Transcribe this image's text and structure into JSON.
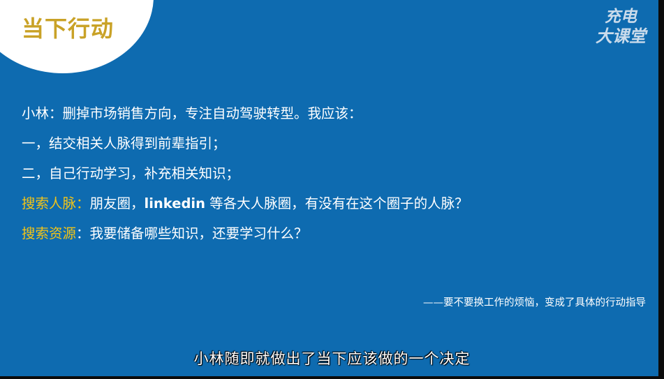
{
  "slide": {
    "title": "当下行动",
    "logo": {
      "line1": "充电",
      "line2": "大课堂"
    },
    "lines": {
      "l1": "小林：删掉市场销售方向，专注自动驾驶转型。我应该：",
      "l2": "一，结交相关人脉得到前辈指引；",
      "l3": "二，自己行动学习，补充相关知识；",
      "l4": {
        "label": "搜索人脉：",
        "text_a": "朋友圈，",
        "keyword": "linkedin",
        "text_b": " 等各大人脉圈，有没有在这个圈子的人脉？"
      },
      "l5": {
        "label": "搜索资源",
        "text": "：我要储备哪些知识，还要学习什么？"
      }
    },
    "footnote": "——要不要换工作的烦恼，变成了具体的行动指导"
  },
  "subtitle": "小林随即就做出了当下应该做的一个决定",
  "colors": {
    "background": "#0e6bb0",
    "title": "#c9a227",
    "highlight": "#f2c418",
    "text": "#ffffff"
  }
}
